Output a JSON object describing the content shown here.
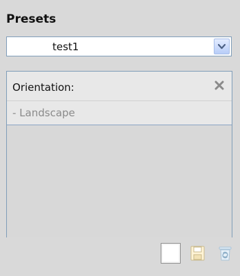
{
  "presets": {
    "title": "Presets",
    "selected": "test1"
  },
  "list": {
    "items": [
      {
        "label": "Orientation:",
        "value": "- Landscape"
      }
    ]
  },
  "icons": {
    "dropdown": "chevron-down-icon",
    "remove": "close-icon",
    "new": "new-icon",
    "save": "save-icon",
    "delete": "trash-icon"
  }
}
